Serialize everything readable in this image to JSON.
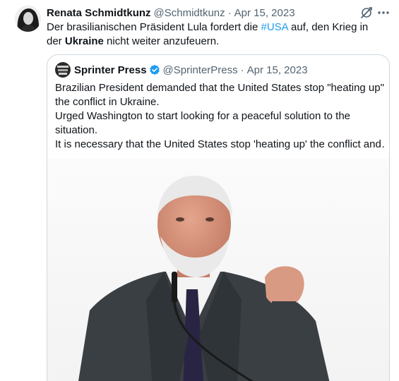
{
  "tweet": {
    "author_name": "Renata Schmidtkunz",
    "author_handle": "@Schmidtkunz",
    "separator": "·",
    "date": "Apr 15, 2023",
    "text_before_hashtag": "Der brasilianischen Präsident Lula fordert die ",
    "hashtag": "#USA",
    "text_after_hashtag": " auf, den Krieg in der ",
    "bold_word": "Ukraine",
    "text_end": " nicht weiter anzufeuern."
  },
  "quoted_tweet": {
    "author_name": "Sprinter Press",
    "author_handle": "@SprinterPress",
    "separator": "·",
    "date": "Apr 15, 2023",
    "lines": [
      "Brazilian President demanded that the United States stop \"heating up\" the conflict in Ukraine.",
      "Urged Washington to start looking for a peaceful solution to the situation.",
      "It is necessary that the United States stop 'heating up' the conflict and…"
    ]
  },
  "icons": {
    "grok": "grok-icon",
    "more": "more-icon",
    "verified": "verified-badge-icon"
  },
  "colors": {
    "link": "#1d9bf0",
    "secondary_text": "#536471",
    "border": "#cfd9de",
    "verified": "#1d9bf0"
  }
}
